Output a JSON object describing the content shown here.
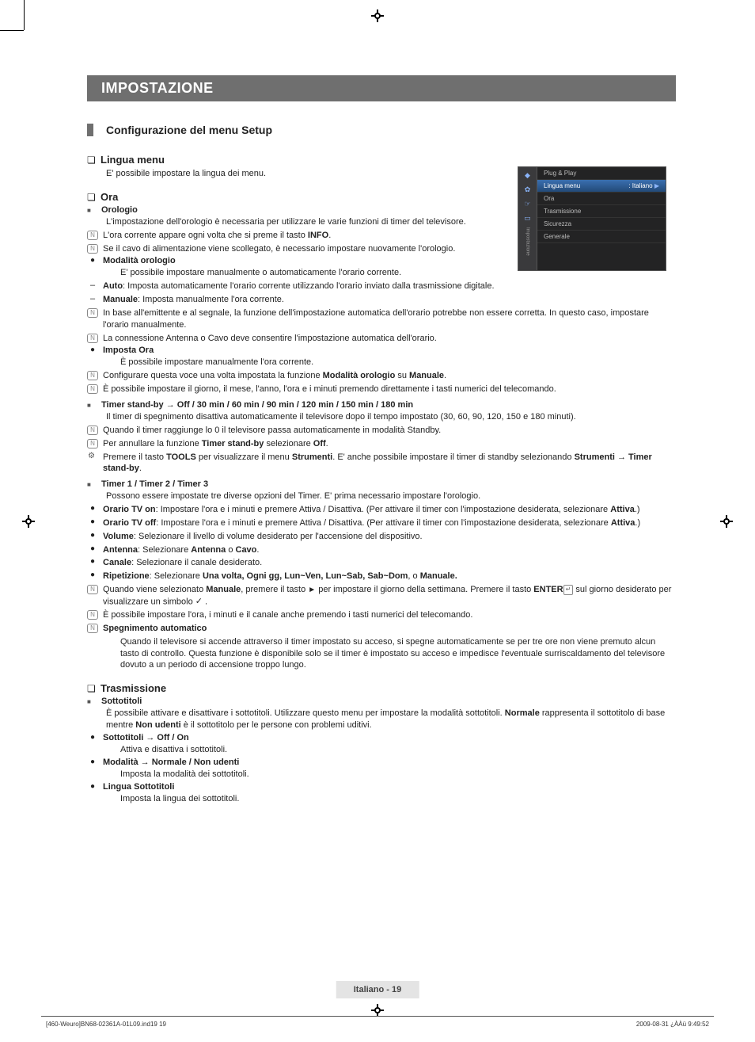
{
  "header": {
    "title": "IMPOSTAZIONE"
  },
  "h2": {
    "title": "Configurazione del menu Setup"
  },
  "s1": {
    "title": "Lingua menu",
    "desc": "E' possibile impostare la lingua dei menu."
  },
  "s2": {
    "title": "Ora"
  },
  "orologio": {
    "title": "Orologio",
    "desc": "L'impostazione dell'orologio è necessaria per utilizzare le varie funzioni di timer del televisore.",
    "n1a": "L'ora corrente appare ogni volta che si preme il tasto ",
    "n1b": "INFO",
    "n1c": ".",
    "n2": "Se il cavo di alimentazione viene scollegato, è necessario impostare nuovamente l'orologio."
  },
  "modalita": {
    "title": "Modalità orologio",
    "desc": "E' possibile impostare manualmente o automaticamente l'orario corrente.",
    "auto_l": "Auto",
    "auto_t": ": Imposta automaticamente l'orario corrente utilizzando l'orario inviato dalla trasmissione digitale.",
    "man_l": "Manuale",
    "man_t": ": Imposta manualmente l'ora corrente.",
    "n1": "In base all'emittente e al segnale, la funzione dell'impostazione automatica dell'orario potrebbe non essere corretta. In questo caso, impostare l'orario manualmente.",
    "n2": "La connessione Antenna o Cavo deve consentire l'impostazione automatica dell'orario."
  },
  "impora": {
    "title": "Imposta Ora",
    "desc": "È possibile impostare manualmente l'ora corrente.",
    "n1a": "Configurare questa voce una volta impostata la funzione ",
    "n1b": "Modalità orologio",
    "n1c": " su ",
    "n1d": "Manuale",
    "n1e": ".",
    "n2": "È possibile impostare il giorno, il mese, l'anno, l'ora e i minuti premendo direttamente i tasti numerici del telecomando."
  },
  "tsb": {
    "title": "Timer stand-by  →  Off / 30 min / 60 min / 90 min / 120 min / 150 min / 180 min",
    "desc": "Il timer di spegnimento disattiva automaticamente il televisore dopo il tempo impostato (30, 60, 90, 120, 150 e 180 minuti).",
    "n1": "Quando il timer raggiunge lo 0 il televisore passa automaticamente in modalità Standby.",
    "n2a": "Per annullare la funzione ",
    "n2b": "Timer stand-by",
    "n2c": " selezionare ",
    "n2d": "Off",
    "n2e": ".",
    "t1a": "Premere il tasto ",
    "t1b": "TOOLS",
    "t1c": " per visualizzare il menu ",
    "t1d": "Strumenti",
    "t1e": ". E' anche possibile impostare il timer di standby selezionando ",
    "t1f": "Strumenti → Timer stand-by",
    "t1g": "."
  },
  "timers": {
    "title": "Timer 1 / Timer 2 / Timer 3",
    "desc": "Possono essere impostate tre diverse opzioni del Timer. E' prima necessario impostare l'orologio.",
    "r1l": "Orario TV on",
    "r1t": ": Impostare l'ora e i minuti e premere Attiva / Disattiva. (Per attivare il timer con l'impostazione desiderata, selezionare ",
    "r1a": "Attiva",
    "r1e": ".)",
    "r2l": "Orario TV off",
    "r2t": ": Impostare l'ora e i minuti e premere Attiva / Disattiva. (Per attivare il timer con l'impostazione desiderata, selezionare ",
    "r2a": "Attiva",
    "r2e": ".)",
    "r3l": "Volume",
    "r3t": ": Selezionare il livello di volume desiderato per l'accensione del dispositivo.",
    "r4l": "Antenna",
    "r4t": ": Selezionare ",
    "r4a": "Antenna",
    "r4m": " o ",
    "r4b": "Cavo",
    "r4e": ".",
    "r5l": "Canale",
    "r5t": ": Selezionare il canale desiderato.",
    "r6l": "Ripetizione",
    "r6t": ": Selezionare ",
    "r6o": "Una volta, Ogni gg, Lun~Ven, Lun~Sab, Sab~Dom",
    "r6m": ", o ",
    "r6b": "Manuale.",
    "r6n1a": "Quando viene selezionato ",
    "r6n1b": "Manuale",
    "r6n1c": ", premere il tasto ",
    "r6n1d": " per impostare il giorno della settimana. Premere il tasto ",
    "r6n1e": "ENTER",
    "r6n1f": " sul giorno desiderato per visualizzare un simbolo ",
    "r6n1g": " .",
    "n2": "È possibile impostare l'ora, i minuti e il canale anche premendo i tasti numerici del telecomando.",
    "n3t": "Spegnimento automatico",
    "n3": "Quando il televisore si accende attraverso il timer impostato su acceso, si spegne automaticamente se per tre ore non viene premuto alcun tasto di controllo. Questa funzione è disponibile solo se il timer è impostato su acceso e impedisce l'eventuale surriscaldamento del televisore dovuto a un periodo di accensione troppo lungo."
  },
  "tras": {
    "title": "Trasmissione",
    "sub": "Sottotitoli",
    "desc1": "È possibile attivare e disattivare i sottotitoli. Utilizzare questo menu per impostare la modalità sottotitoli. ",
    "desc1b": "Normale",
    "desc1c": " rappresenta il sottotitolo di base mentre ",
    "desc1d": "Non udenti",
    "desc1e": " è il sottotitolo per le persone con problemi uditivi.",
    "i1l": "Sottotitoli → Off / On",
    "i1t": "Attiva e disattiva i sottotitoli.",
    "i2l": "Modalità → Normale / Non udenti",
    "i2t": "Imposta la modalità dei sottotitoli.",
    "i3l": "Lingua Sottotitoli",
    "i3t": "Imposta la lingua dei sottotitoli."
  },
  "osd": {
    "sidebar_label": "Impostazione",
    "items": [
      {
        "label": "Plug & Play",
        "value": ""
      },
      {
        "label": "Lingua menu",
        "value": ": Italiano"
      },
      {
        "label": "Ora",
        "value": ""
      },
      {
        "label": "Trasmissione",
        "value": ""
      },
      {
        "label": "Sicurezza",
        "value": ""
      },
      {
        "label": "Generale",
        "value": ""
      }
    ]
  },
  "footer": {
    "label": "Italiano - 19",
    "left": "[460-Weuro]BN68-02361A-01L09.ind19   19",
    "right": "2009-08-31   ¿ÀÀü 9:49:52"
  }
}
